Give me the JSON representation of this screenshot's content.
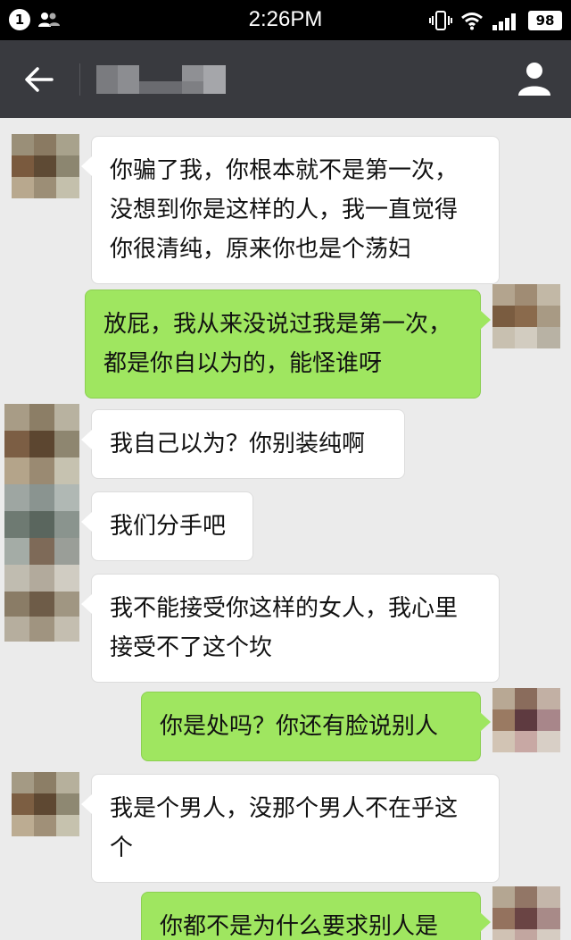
{
  "status_bar": {
    "notification_count": "1",
    "time": "2:26PM",
    "battery": "98",
    "icons": [
      "people-icon",
      "vibrate-icon",
      "wifi-icon",
      "signal-icon",
      "battery-icon"
    ]
  },
  "nav": {
    "back_icon": "back-arrow-icon",
    "title_obscured": true,
    "profile_icon": "person-icon",
    "background": "#393a3f"
  },
  "colors": {
    "chat_background": "#ebebeb",
    "incoming_bubble": "#ffffff",
    "outgoing_bubble": "#9fe660"
  },
  "messages": [
    {
      "side": "in",
      "text": "你骗了我，你根本就不是第一次，\n没想到你是这样的人，我一直觉得\n你很清纯，原来你也是个荡妇"
    },
    {
      "side": "out",
      "text": "放屁，我从来没说过我是第一次，\n都是你自以为的，能怪谁呀"
    },
    {
      "side": "in",
      "text": "我自己以为？你别装纯啊"
    },
    {
      "side": "in",
      "text": "我们分手吧"
    },
    {
      "side": "in",
      "text": "我不能接受你这样的女人，我心里\n接受不了这个坎"
    },
    {
      "side": "out",
      "text": "你是处吗？你还有脸说别人"
    },
    {
      "side": "in",
      "text": "我是个男人，没那个男人不在乎这\n个"
    },
    {
      "side": "out",
      "text": "你都不是为什么要求别人是"
    }
  ]
}
